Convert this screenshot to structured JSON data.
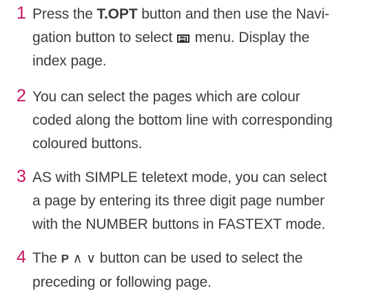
{
  "steps": [
    {
      "number": "1",
      "line1_prefix": "Press the ",
      "line1_bold": "T.OPT",
      "line1_suffix": " button and then use the Navi-",
      "line2_prefix": "gation button to select ",
      "line2_icon": "teletext-menu-icon",
      "line2_suffix": " menu. Display the",
      "line3": "index page."
    },
    {
      "number": "2",
      "line1": "You can select the pages which are colour",
      "line2": "coded along the bottom line with corresponding",
      "line3": "coloured buttons."
    },
    {
      "number": "3",
      "line1": "AS with SIMPLE teletext mode, you can select",
      "line2": "a page by entering its three digit page number",
      "line3": "with the NUMBER buttons in FASTEXT mode."
    },
    {
      "number": "4",
      "line1_prefix": "The ",
      "line1_p": "P",
      "line1_up": "∧",
      "line1_down": "∨",
      "line1_suffix": " button can be used to select the",
      "line2": "preceding or following page."
    }
  ],
  "colors": {
    "step_number": "#c5135f",
    "text": "#3c3c3c"
  }
}
